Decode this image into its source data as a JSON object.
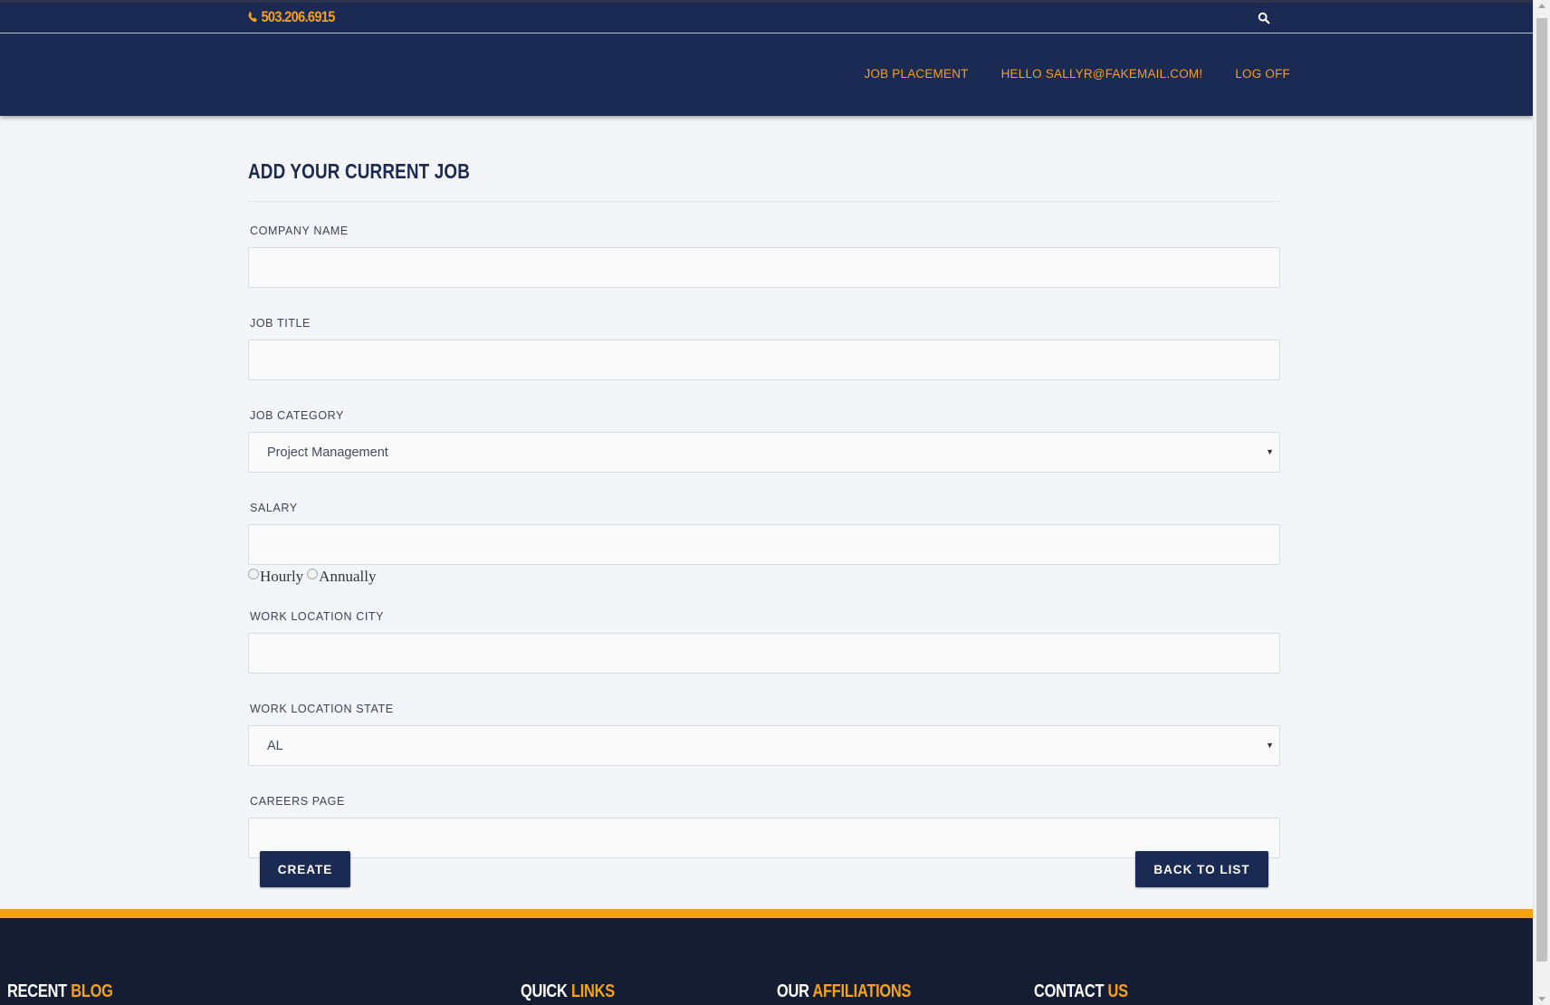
{
  "header": {
    "phone": "503.206.6915",
    "nav": [
      {
        "label": "JOB PLACEMENT"
      },
      {
        "label": "HELLO SALLYR@FAKEMAIL.COM!"
      },
      {
        "label": "LOG OFF"
      }
    ]
  },
  "form": {
    "title": "ADD YOUR CURRENT JOB",
    "company_name": {
      "label": "COMPANY NAME",
      "value": ""
    },
    "job_title": {
      "label": "JOB TITLE",
      "value": ""
    },
    "job_category": {
      "label": "JOB CATEGORY",
      "selected": "Project Management"
    },
    "salary": {
      "label": "SALARY",
      "value": "",
      "options": [
        "Hourly",
        "Annually"
      ]
    },
    "work_city": {
      "label": "WORK LOCATION CITY",
      "value": ""
    },
    "work_state": {
      "label": "WORK LOCATION STATE",
      "selected": "AL"
    },
    "careers_page": {
      "label": "CAREERS PAGE",
      "value": ""
    },
    "create_label": "CREATE",
    "back_label": "BACK TO LIST"
  },
  "footer": {
    "headings": [
      {
        "word": "RECENT",
        "accent": "BLOG"
      },
      {
        "word": "QUICK",
        "accent": "LINKS"
      },
      {
        "word": "OUR",
        "accent": "AFFILIATIONS"
      },
      {
        "word": "CONTACT",
        "accent": "US"
      }
    ]
  },
  "colors": {
    "navy": "#1a2a52",
    "orange": "#f59f1c",
    "footer_bg": "#141d31"
  }
}
